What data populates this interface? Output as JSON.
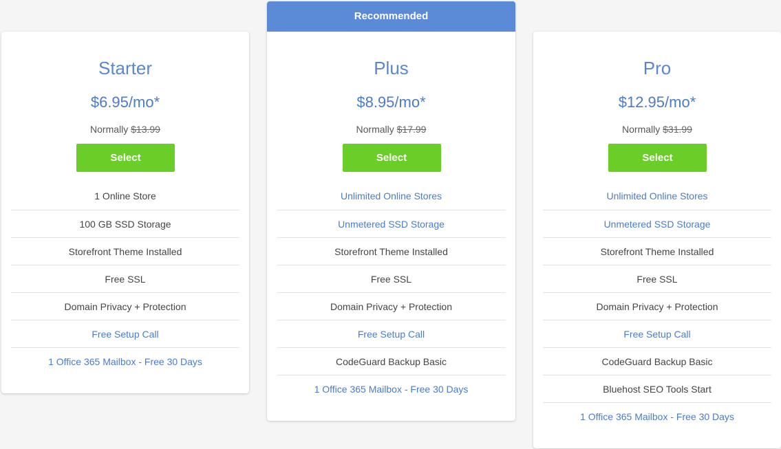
{
  "colors": {
    "accent": "#5a87cf",
    "price": "#4a7cc7",
    "ribbon": "#5b8ad6",
    "button": "#6acd28",
    "link": "#4a7cc7",
    "text": "#444444"
  },
  "plans": [
    {
      "name": "Starter",
      "price": "$6.95/mo*",
      "normally_label": "Normally",
      "normal_price": "$13.99",
      "button": "Select",
      "features": [
        {
          "text": "1 Online Store",
          "highlight": false
        },
        {
          "text": "100 GB SSD Storage",
          "highlight": false
        },
        {
          "text": "Storefront Theme Installed",
          "highlight": false
        },
        {
          "text": "Free SSL",
          "highlight": false
        },
        {
          "text": "Domain Privacy + Protection",
          "highlight": false
        },
        {
          "text": "Free Setup Call",
          "highlight": true
        },
        {
          "text": "1 Office 365 Mailbox - Free 30 Days",
          "highlight": true
        }
      ]
    },
    {
      "ribbon": "Recommended",
      "name": "Plus",
      "price": "$8.95/mo*",
      "normally_label": "Normally",
      "normal_price": "$17.99",
      "button": "Select",
      "features": [
        {
          "text": "Unlimited Online Stores",
          "highlight": true
        },
        {
          "text": "Unmetered SSD Storage",
          "highlight": true
        },
        {
          "text": "Storefront Theme Installed",
          "highlight": false
        },
        {
          "text": "Free SSL",
          "highlight": false
        },
        {
          "text": "Domain Privacy + Protection",
          "highlight": false
        },
        {
          "text": "Free Setup Call",
          "highlight": true
        },
        {
          "text": "CodeGuard Backup Basic",
          "highlight": false
        },
        {
          "text": "1 Office 365 Mailbox - Free 30 Days",
          "highlight": true
        }
      ]
    },
    {
      "name": "Pro",
      "price": "$12.95/mo*",
      "normally_label": "Normally",
      "normal_price": "$31.99",
      "button": "Select",
      "features": [
        {
          "text": "Unlimited Online Stores",
          "highlight": true
        },
        {
          "text": "Unmetered SSD Storage",
          "highlight": true
        },
        {
          "text": "Storefront Theme Installed",
          "highlight": false
        },
        {
          "text": "Free SSL",
          "highlight": false
        },
        {
          "text": "Domain Privacy + Protection",
          "highlight": false
        },
        {
          "text": "Free Setup Call",
          "highlight": true
        },
        {
          "text": "CodeGuard Backup Basic",
          "highlight": false
        },
        {
          "text": "Bluehost SEO Tools Start",
          "highlight": false
        },
        {
          "text": "1 Office 365 Mailbox - Free 30 Days",
          "highlight": true
        }
      ]
    }
  ]
}
